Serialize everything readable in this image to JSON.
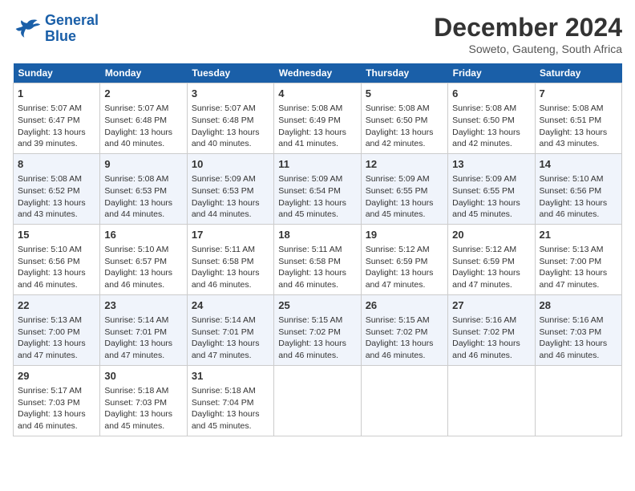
{
  "logo": {
    "line1": "General",
    "line2": "Blue"
  },
  "title": "December 2024",
  "subtitle": "Soweto, Gauteng, South Africa",
  "weekdays": [
    "Sunday",
    "Monday",
    "Tuesday",
    "Wednesday",
    "Thursday",
    "Friday",
    "Saturday"
  ],
  "weeks": [
    [
      {
        "day": "1",
        "rise": "5:07 AM",
        "set": "6:47 PM",
        "daylight": "13 hours and 39 minutes."
      },
      {
        "day": "2",
        "rise": "5:07 AM",
        "set": "6:48 PM",
        "daylight": "13 hours and 40 minutes."
      },
      {
        "day": "3",
        "rise": "5:07 AM",
        "set": "6:48 PM",
        "daylight": "13 hours and 40 minutes."
      },
      {
        "day": "4",
        "rise": "5:08 AM",
        "set": "6:49 PM",
        "daylight": "13 hours and 41 minutes."
      },
      {
        "day": "5",
        "rise": "5:08 AM",
        "set": "6:50 PM",
        "daylight": "13 hours and 42 minutes."
      },
      {
        "day": "6",
        "rise": "5:08 AM",
        "set": "6:50 PM",
        "daylight": "13 hours and 42 minutes."
      },
      {
        "day": "7",
        "rise": "5:08 AM",
        "set": "6:51 PM",
        "daylight": "13 hours and 43 minutes."
      }
    ],
    [
      {
        "day": "8",
        "rise": "5:08 AM",
        "set": "6:52 PM",
        "daylight": "13 hours and 43 minutes."
      },
      {
        "day": "9",
        "rise": "5:08 AM",
        "set": "6:53 PM",
        "daylight": "13 hours and 44 minutes."
      },
      {
        "day": "10",
        "rise": "5:09 AM",
        "set": "6:53 PM",
        "daylight": "13 hours and 44 minutes."
      },
      {
        "day": "11",
        "rise": "5:09 AM",
        "set": "6:54 PM",
        "daylight": "13 hours and 45 minutes."
      },
      {
        "day": "12",
        "rise": "5:09 AM",
        "set": "6:55 PM",
        "daylight": "13 hours and 45 minutes."
      },
      {
        "day": "13",
        "rise": "5:09 AM",
        "set": "6:55 PM",
        "daylight": "13 hours and 45 minutes."
      },
      {
        "day": "14",
        "rise": "5:10 AM",
        "set": "6:56 PM",
        "daylight": "13 hours and 46 minutes."
      }
    ],
    [
      {
        "day": "15",
        "rise": "5:10 AM",
        "set": "6:56 PM",
        "daylight": "13 hours and 46 minutes."
      },
      {
        "day": "16",
        "rise": "5:10 AM",
        "set": "6:57 PM",
        "daylight": "13 hours and 46 minutes."
      },
      {
        "day": "17",
        "rise": "5:11 AM",
        "set": "6:58 PM",
        "daylight": "13 hours and 46 minutes."
      },
      {
        "day": "18",
        "rise": "5:11 AM",
        "set": "6:58 PM",
        "daylight": "13 hours and 46 minutes."
      },
      {
        "day": "19",
        "rise": "5:12 AM",
        "set": "6:59 PM",
        "daylight": "13 hours and 47 minutes."
      },
      {
        "day": "20",
        "rise": "5:12 AM",
        "set": "6:59 PM",
        "daylight": "13 hours and 47 minutes."
      },
      {
        "day": "21",
        "rise": "5:13 AM",
        "set": "7:00 PM",
        "daylight": "13 hours and 47 minutes."
      }
    ],
    [
      {
        "day": "22",
        "rise": "5:13 AM",
        "set": "7:00 PM",
        "daylight": "13 hours and 47 minutes."
      },
      {
        "day": "23",
        "rise": "5:14 AM",
        "set": "7:01 PM",
        "daylight": "13 hours and 47 minutes."
      },
      {
        "day": "24",
        "rise": "5:14 AM",
        "set": "7:01 PM",
        "daylight": "13 hours and 47 minutes."
      },
      {
        "day": "25",
        "rise": "5:15 AM",
        "set": "7:02 PM",
        "daylight": "13 hours and 46 minutes."
      },
      {
        "day": "26",
        "rise": "5:15 AM",
        "set": "7:02 PM",
        "daylight": "13 hours and 46 minutes."
      },
      {
        "day": "27",
        "rise": "5:16 AM",
        "set": "7:02 PM",
        "daylight": "13 hours and 46 minutes."
      },
      {
        "day": "28",
        "rise": "5:16 AM",
        "set": "7:03 PM",
        "daylight": "13 hours and 46 minutes."
      }
    ],
    [
      {
        "day": "29",
        "rise": "5:17 AM",
        "set": "7:03 PM",
        "daylight": "13 hours and 46 minutes."
      },
      {
        "day": "30",
        "rise": "5:18 AM",
        "set": "7:03 PM",
        "daylight": "13 hours and 45 minutes."
      },
      {
        "day": "31",
        "rise": "5:18 AM",
        "set": "7:04 PM",
        "daylight": "13 hours and 45 minutes."
      },
      null,
      null,
      null,
      null
    ]
  ],
  "labels": {
    "sunrise": "Sunrise:",
    "sunset": "Sunset:",
    "daylight": "Daylight:"
  }
}
